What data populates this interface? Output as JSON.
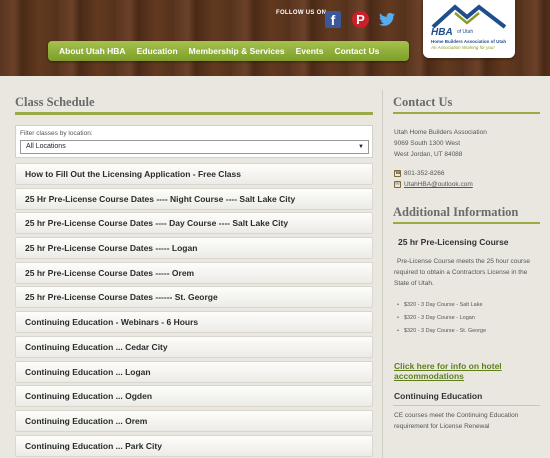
{
  "header": {
    "follow_label": "FOLLOW US ON",
    "social": {
      "facebook": "f",
      "pinterest": "P",
      "twitter": "twitter-bird"
    },
    "logo": {
      "hba": "HBA",
      "of_utah": "of Utah",
      "name": "Home Builders Association of Utah",
      "tagline": "An Association Working for you!"
    },
    "nav": [
      "About Utah HBA",
      "Education",
      "Membership & Services",
      "Events",
      "Contact Us"
    ]
  },
  "class_schedule": {
    "title": "Class Schedule",
    "filter_label": "Filter classes by location:",
    "filter_value": "All Locations",
    "items": [
      "How to Fill Out the Licensing Application - Free Class",
      "25 Hr Pre-License Course Dates ---- Night Course ---- Salt Lake City",
      "25 hr Pre-License Course Dates ---- Day Course ---- Salt Lake City",
      "25 hr Pre-License Course Dates ----- Logan",
      "25 hr Pre-License Course Dates ----- Orem",
      "25 hr Pre-License Course Dates ------ St. George",
      "Continuing Education - Webinars - 6 Hours",
      "Continuing Education ... Cedar City",
      "Continuing Education ... Logan",
      "Continuing Education ... Ogden",
      "Continuing Education ... Orem",
      "Continuing Education ... Park City"
    ]
  },
  "contact": {
    "title": "Contact Us",
    "org": "Utah Home Builders Association",
    "street": "9069 South 1300 West",
    "city": "West Jordan, UT 84088",
    "phone": "801-352-8266",
    "email": "UtahHBA@outlook.com"
  },
  "additional": {
    "title": "Additional Information",
    "course_head": "25 hr Pre-Licensing Course",
    "course_body": "Pre-License Course meets the 25 hour course required to obtain a Contractors License in the State of Utah.",
    "bullets": [
      "$320 - 3 Day Course - Salt Lake",
      "$320 - 3 Day Course - Logan",
      "$320 - 3 Day Course - St. George"
    ],
    "hotel_link": "Click here for info on hotel accommodations",
    "ce_head": "Continuing Education",
    "ce_body": "CE courses meet the Continuing Education requirement for License Renewal"
  },
  "colors": {
    "accent_green": "#9aaa45",
    "nav_green": "#8fb03a",
    "wood_brown": "#5a3520"
  }
}
